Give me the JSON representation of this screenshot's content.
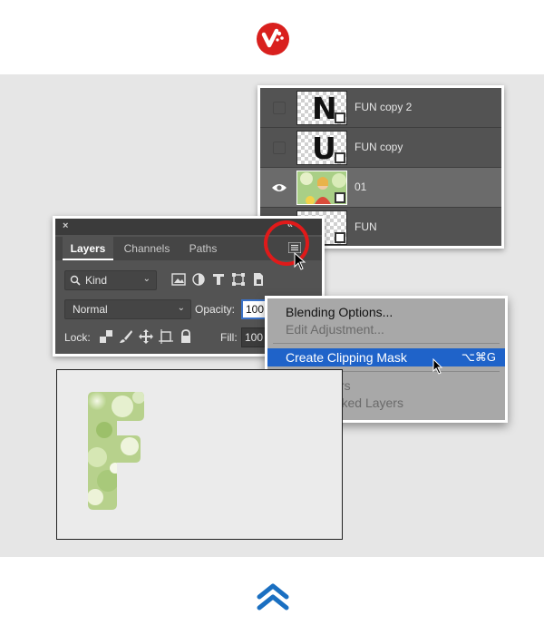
{
  "brand": {
    "logo_icon": "brand-logo-icon",
    "accent": "#d9201e",
    "nav_accent": "#1a6fc1"
  },
  "nav": {
    "scroll_top_icon": "double-chevron-up-icon"
  },
  "layers_list": {
    "rows": [
      {
        "name": "FUN copy 2",
        "thumb_letter": "N",
        "visible": false,
        "selected": false
      },
      {
        "name": "FUN copy",
        "thumb_letter": "U",
        "visible": false,
        "selected": false
      },
      {
        "name": "01",
        "thumb_letter": "",
        "visible": true,
        "selected": true
      },
      {
        "name": "FUN",
        "thumb_letter": "",
        "visible": false,
        "selected": false
      }
    ]
  },
  "panel": {
    "close_glyph": "×",
    "collapse_glyph": "«",
    "tabs": [
      "Layers",
      "Channels",
      "Paths"
    ],
    "active_tab": "Layers",
    "kind_filter": "Kind",
    "blend_mode": "Normal",
    "opacity_label": "Opacity:",
    "opacity_value": "100",
    "lock_label": "Lock:",
    "fill_label": "Fill:",
    "fill_value": "100",
    "menu_icon": "panel-menu-icon",
    "highlight_color": "#e01a1a"
  },
  "context_menu": {
    "items": [
      {
        "label": "Blending Options...",
        "enabled": true
      },
      {
        "label": "Edit Adjustment...",
        "enabled": false
      },
      {
        "label": "Create Clipping Mask",
        "enabled": true,
        "highlighted": true,
        "shortcut": "⌥⌘G"
      },
      {
        "label": "Link Layers",
        "enabled": false
      },
      {
        "label": "Select Linked Layers",
        "enabled": false
      }
    ]
  },
  "canvas": {
    "letter": "F"
  }
}
